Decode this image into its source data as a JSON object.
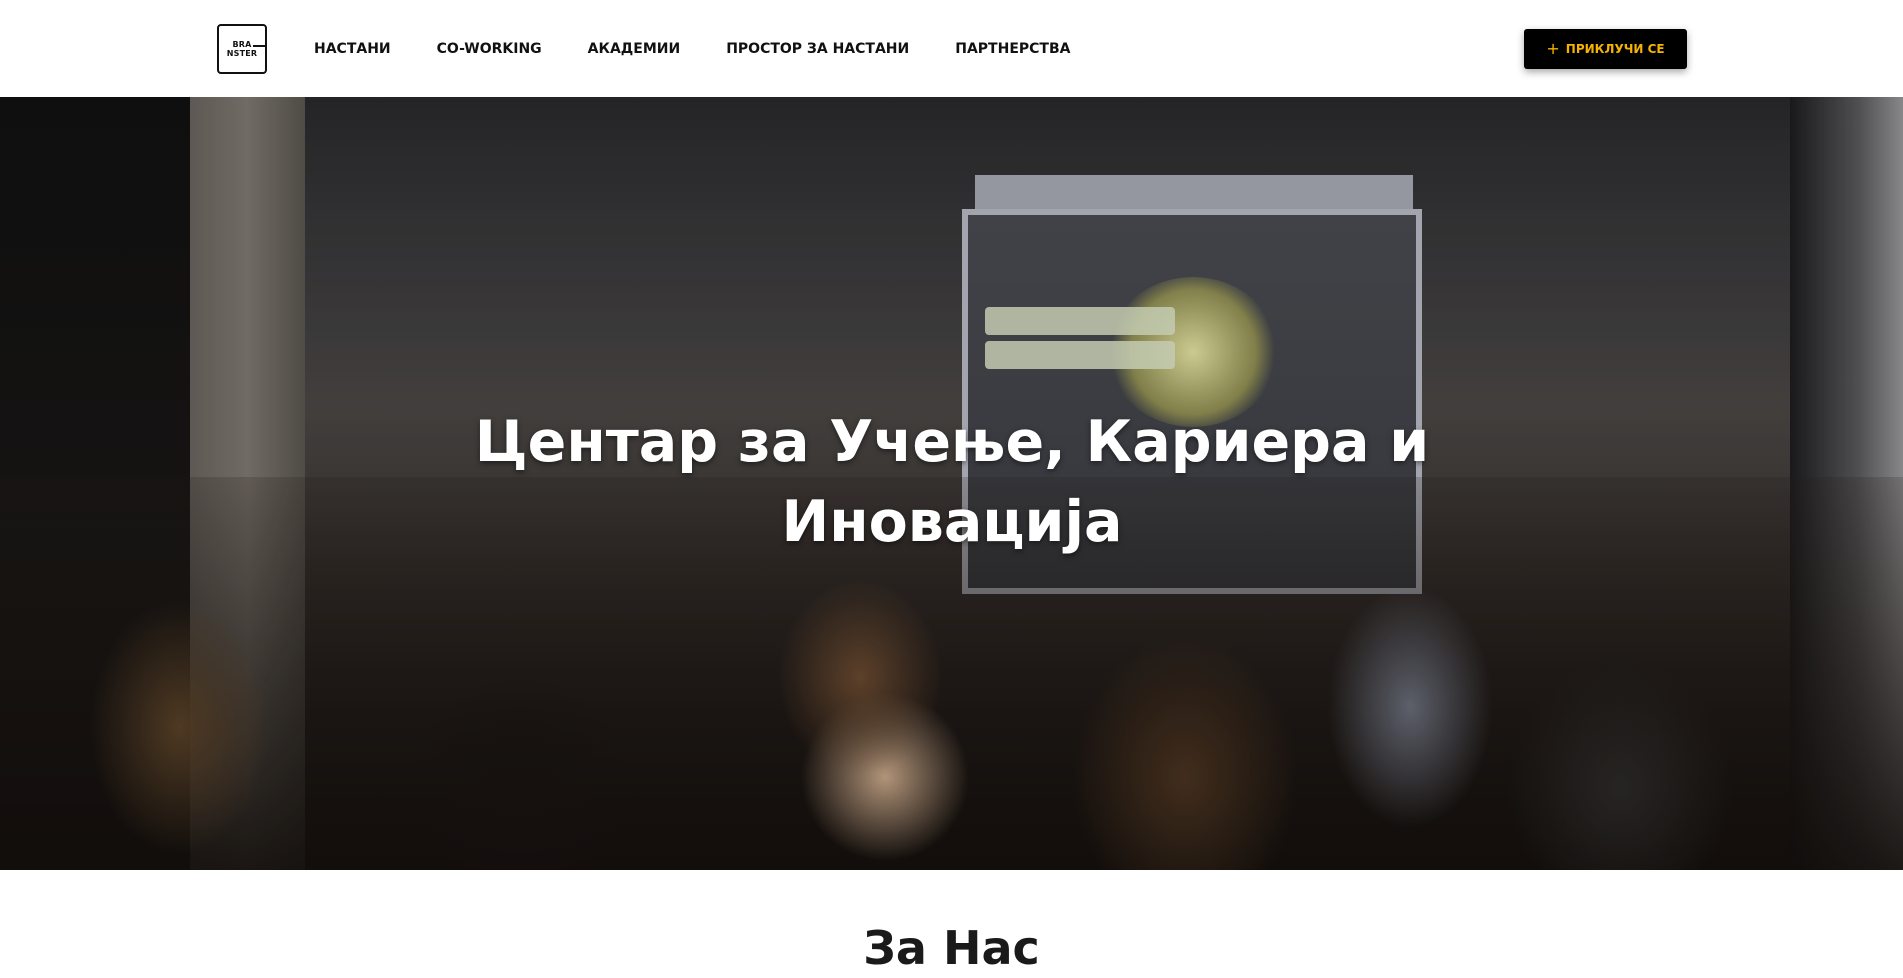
{
  "header": {
    "logo": {
      "line1": "BRA",
      "line2": "NSTER"
    },
    "nav": [
      {
        "label": "НАСТАНИ"
      },
      {
        "label": "CO-WORKING"
      },
      {
        "label": "АКАДЕМИИ"
      },
      {
        "label": "ПРОСТОР ЗА НАСТАНИ"
      },
      {
        "label": "ПАРТНЕРСТВА"
      }
    ],
    "join_button": {
      "icon": "plus-icon",
      "label": "ПРИКЛУЧИ СЕ"
    }
  },
  "hero": {
    "title": "Центар за Учење, Кариера и Иновација"
  },
  "about": {
    "title": "За Нас"
  },
  "colors": {
    "accent": "#f5b301",
    "button_bg": "#000000",
    "text": "#111111"
  }
}
